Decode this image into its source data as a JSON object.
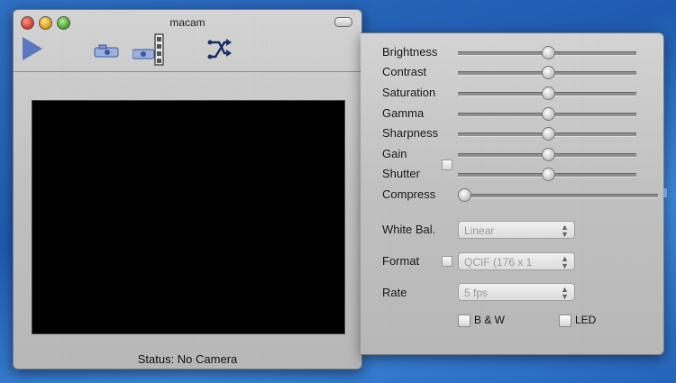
{
  "window": {
    "title": "macam"
  },
  "toolbar": {
    "items": [
      {
        "icon": "play-icon"
      },
      {
        "icon": "camera-snapshot-icon"
      },
      {
        "icon": "film-record-icon"
      },
      {
        "icon": "shuffle-icon"
      }
    ]
  },
  "status": {
    "text": "Status: No Camera"
  },
  "settings": {
    "sliders": [
      {
        "label": "Brightness",
        "value": 0.5
      },
      {
        "label": "Contrast",
        "value": 0.5
      },
      {
        "label": "Saturation",
        "value": 0.5
      },
      {
        "label": "Gamma",
        "value": 0.5
      },
      {
        "label": "Sharpness",
        "value": 0.5
      },
      {
        "label": "Gain",
        "value": 0.5
      },
      {
        "label": "Shutter",
        "value": 0.5
      },
      {
        "label": "Compress",
        "value": 0.0
      }
    ],
    "white_bal": {
      "label": "White Bal.",
      "value": "Linear"
    },
    "format": {
      "label": "Format",
      "value": "QCIF (176 x 1"
    },
    "rate": {
      "label": "Rate",
      "value": "5 fps"
    },
    "bw": {
      "label": "B & W",
      "checked": false
    },
    "led": {
      "label": "LED",
      "checked": false
    }
  },
  "colors": {
    "video_background": "#000000",
    "desktop": "#2e6fc0"
  }
}
